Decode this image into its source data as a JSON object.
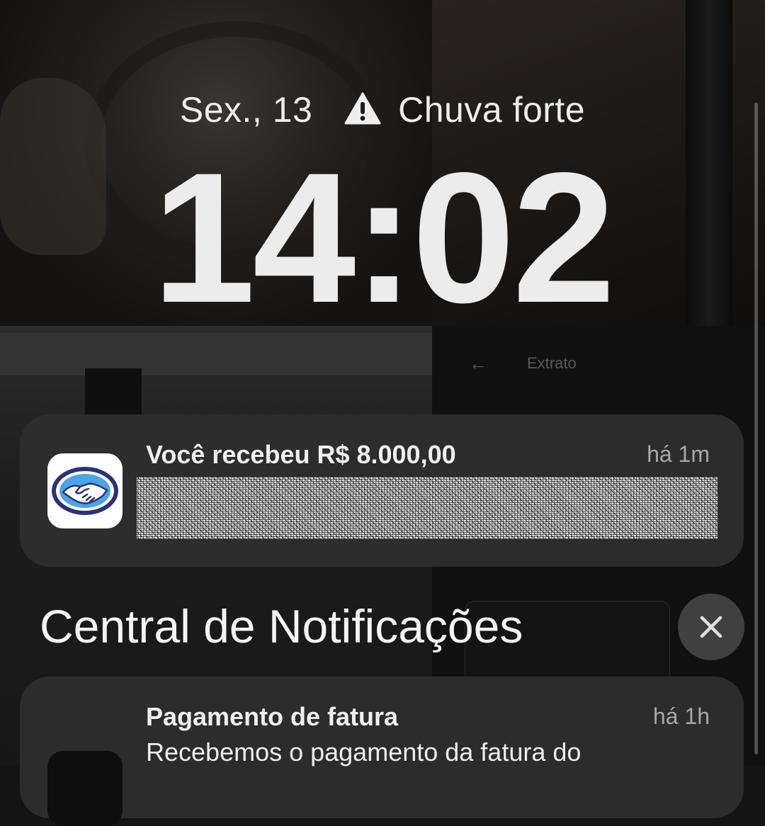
{
  "lockscreen": {
    "date": "Sex., 13",
    "weather_alert": "Chuva forte",
    "time": "14:02"
  },
  "background_ghost": {
    "screen_title": "Extrato"
  },
  "notifications": [
    {
      "app_icon": "mercado-pago-handshake-icon",
      "title": "Você recebeu R$ 8.000,00",
      "time": "há 1m",
      "body_redacted": true
    }
  ],
  "notification_center": {
    "title": "Central de Notificações",
    "close_icon": "close-icon",
    "items": [
      {
        "title": "Pagamento de fatura",
        "time": "há 1h",
        "body": "Recebemos o pagamento da fatura do"
      }
    ]
  },
  "colors": {
    "card_bg": "#2e2e2e",
    "text_primary": "#f0f0f0",
    "text_secondary": "#a8a8a8",
    "mp_blue": "#2d3277",
    "mp_light_blue": "#4aa4e8"
  }
}
